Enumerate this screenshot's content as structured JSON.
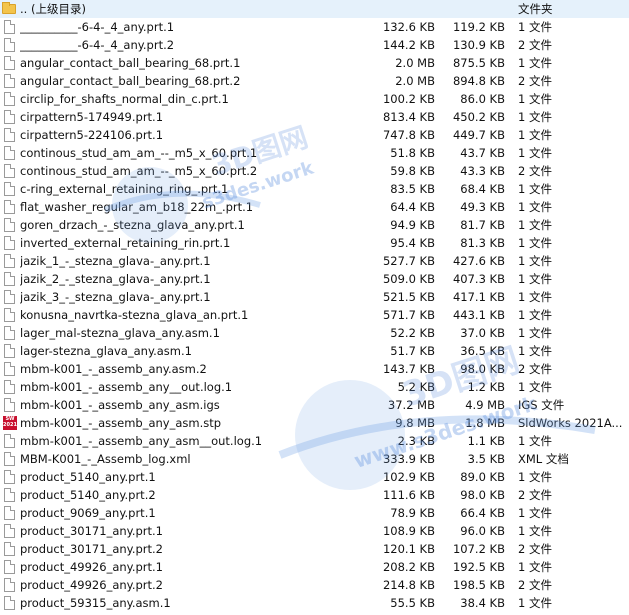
{
  "files": [
    {
      "icon": "folder",
      "name": ".. (上级目录)",
      "size": "",
      "packed": "",
      "type": "文件夹"
    },
    {
      "icon": "file",
      "name": "__________-6-4-_4_any.prt.1",
      "size": "132.6 KB",
      "packed": "119.2 KB",
      "type": "1 文件"
    },
    {
      "icon": "file",
      "name": "__________-6-4-_4_any.prt.2",
      "size": "144.2 KB",
      "packed": "130.9 KB",
      "type": "2 文件"
    },
    {
      "icon": "file",
      "name": "angular_contact_ball_bearing_68.prt.1",
      "size": "2.0 MB",
      "packed": "875.5 KB",
      "type": "1 文件"
    },
    {
      "icon": "file",
      "name": "angular_contact_ball_bearing_68.prt.2",
      "size": "2.0 MB",
      "packed": "894.8 KB",
      "type": "2 文件"
    },
    {
      "icon": "file",
      "name": "circlip_for_shafts_normal_din_c.prt.1",
      "size": "100.2 KB",
      "packed": "86.0 KB",
      "type": "1 文件"
    },
    {
      "icon": "file",
      "name": "cirpattern5-174949.prt.1",
      "size": "813.4 KB",
      "packed": "450.2 KB",
      "type": "1 文件"
    },
    {
      "icon": "file",
      "name": "cirpattern5-224106.prt.1",
      "size": "747.8 KB",
      "packed": "449.7 KB",
      "type": "1 文件"
    },
    {
      "icon": "file",
      "name": "continous_stud_am_am_--_m5_x_60.prt.1",
      "size": "51.8 KB",
      "packed": "43.7 KB",
      "type": "1 文件"
    },
    {
      "icon": "file",
      "name": "continous_stud_am_am_--_m5_x_60.prt.2",
      "size": "59.8 KB",
      "packed": "43.3 KB",
      "type": "2 文件"
    },
    {
      "icon": "file",
      "name": "c-ring_external_retaining_ring_.prt.1",
      "size": "83.5 KB",
      "packed": "68.4 KB",
      "type": "1 文件"
    },
    {
      "icon": "file",
      "name": "flat_washer_regular_am_b18_22m_.prt.1",
      "size": "64.4 KB",
      "packed": "49.3 KB",
      "type": "1 文件"
    },
    {
      "icon": "file",
      "name": "goren_drzach_-_stezna_glava_any.prt.1",
      "size": "94.9 KB",
      "packed": "81.7 KB",
      "type": "1 文件"
    },
    {
      "icon": "file",
      "name": "inverted_external_retaining_rin.prt.1",
      "size": "95.4 KB",
      "packed": "81.3 KB",
      "type": "1 文件"
    },
    {
      "icon": "file",
      "name": "jazik_1_-_stezna_glava-_any.prt.1",
      "size": "527.7 KB",
      "packed": "427.6 KB",
      "type": "1 文件"
    },
    {
      "icon": "file",
      "name": "jazik_2_-_stezna_glava-_any.prt.1",
      "size": "509.0 KB",
      "packed": "407.3 KB",
      "type": "1 文件"
    },
    {
      "icon": "file",
      "name": "jazik_3_-_stezna_glava-_any.prt.1",
      "size": "521.5 KB",
      "packed": "417.1 KB",
      "type": "1 文件"
    },
    {
      "icon": "file",
      "name": "konusna_navrtka-stezna_glava_an.prt.1",
      "size": "571.7 KB",
      "packed": "443.1 KB",
      "type": "1 文件"
    },
    {
      "icon": "file",
      "name": "lager_mal-stezna_glava_any.asm.1",
      "size": "52.2 KB",
      "packed": "37.0 KB",
      "type": "1 文件"
    },
    {
      "icon": "file",
      "name": "lager-stezna_glava_any.asm.1",
      "size": "51.7 KB",
      "packed": "36.5 KB",
      "type": "1 文件"
    },
    {
      "icon": "file",
      "name": "mbm-k001_-_assemb_any.asm.2",
      "size": "143.7 KB",
      "packed": "98.0 KB",
      "type": "2 文件"
    },
    {
      "icon": "file",
      "name": "mbm-k001_-_assemb_any__out.log.1",
      "size": "5.2 KB",
      "packed": "1.2 KB",
      "type": "1 文件"
    },
    {
      "icon": "file",
      "name": "mbm-k001_-_assemb_any_asm.igs",
      "size": "37.2 MB",
      "packed": "4.9 MB",
      "type": "IGS 文件"
    },
    {
      "icon": "sw",
      "name": "mbm-k001_-_assemb_any_asm.stp",
      "size": "9.8 MB",
      "packed": "1.8 MB",
      "type": "SldWorks 2021A..."
    },
    {
      "icon": "file",
      "name": "mbm-k001_-_assemb_any_asm__out.log.1",
      "size": "2.3 KB",
      "packed": "1.1 KB",
      "type": "1 文件"
    },
    {
      "icon": "file",
      "name": "MBM-K001_-_Assemb_log.xml",
      "size": "333.9 KB",
      "packed": "3.5 KB",
      "type": "XML 文档"
    },
    {
      "icon": "file",
      "name": "product_5140_any.prt.1",
      "size": "102.9 KB",
      "packed": "89.0 KB",
      "type": "1 文件"
    },
    {
      "icon": "file",
      "name": "product_5140_any.prt.2",
      "size": "111.6 KB",
      "packed": "98.0 KB",
      "type": "2 文件"
    },
    {
      "icon": "file",
      "name": "product_9069_any.prt.1",
      "size": "78.9 KB",
      "packed": "66.4 KB",
      "type": "1 文件"
    },
    {
      "icon": "file",
      "name": "product_30171_any.prt.1",
      "size": "108.9 KB",
      "packed": "96.0 KB",
      "type": "1 文件"
    },
    {
      "icon": "file",
      "name": "product_30171_any.prt.2",
      "size": "120.1 KB",
      "packed": "107.2 KB",
      "type": "2 文件"
    },
    {
      "icon": "file",
      "name": "product_49926_any.prt.1",
      "size": "208.2 KB",
      "packed": "192.5 KB",
      "type": "1 文件"
    },
    {
      "icon": "file",
      "name": "product_49926_any.prt.2",
      "size": "214.8 KB",
      "packed": "198.5 KB",
      "type": "2 文件"
    },
    {
      "icon": "file",
      "name": "product_59315_any.asm.1",
      "size": "55.5 KB",
      "packed": "38.4 KB",
      "type": "1 文件"
    }
  ],
  "sw_badge": {
    "line1": "SW",
    "line2": "2021"
  },
  "watermarks": [
    {
      "text": "ws.work",
      "tag": "wm1"
    },
    {
      "text": "s3des.work",
      "tag": "wm2"
    },
    {
      "text": "3D图网",
      "tag": "wm3"
    },
    {
      "text": "www.s3des.work",
      "tag": "wm4"
    }
  ]
}
